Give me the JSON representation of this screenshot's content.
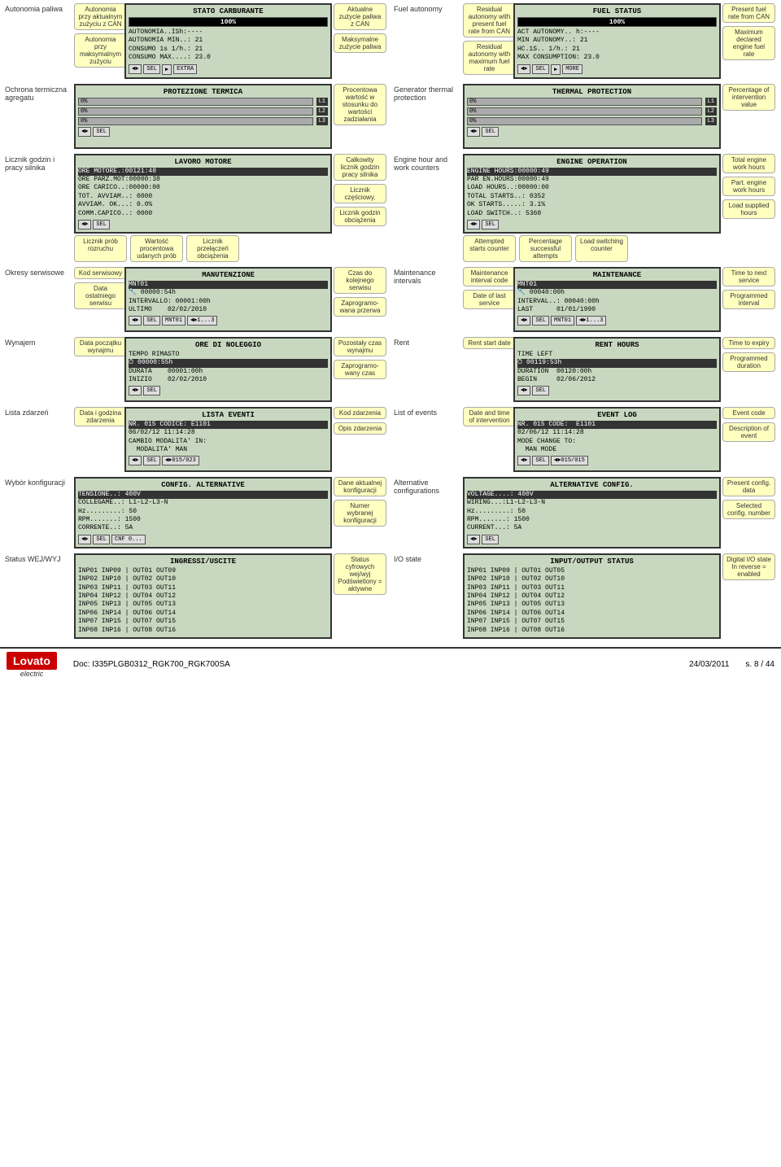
{
  "left_column": {
    "sections": [
      {
        "id": "fuel-autonomy",
        "label": "Autonomia paliwa",
        "screen_title": "STATO CARBURANTE",
        "progress": 100,
        "lines": [
          "AUTONOMIA..ISh:----",
          "AUTONOMIA MIN..: 21",
          "CONSUMO 1s 1/h.: 21",
          "CONSUMO MAX....: 23.0"
        ],
        "controls": [
          "◄►",
          "SEL",
          "▶",
          "EXTRA"
        ],
        "annotations_right": [
          {
            "text": "Aktualne zużycie paliwa z CAN"
          },
          {
            "text": "Maksymalne zużycie paliwa"
          }
        ],
        "annotations_left": [
          {
            "text": "Autonomia przy aktualnym zużyciu z CAN"
          },
          {
            "text": "Autonomia przy maksymalnym zużyciu"
          }
        ]
      },
      {
        "id": "thermal-protection",
        "label": "Ochrona termiczna agregatu",
        "screen_title": "PROTEZIONE TERMICA",
        "lines": [
          "0%",
          "0%",
          "0%"
        ],
        "indicators": [
          "L1",
          "L2",
          "L3"
        ],
        "controls": [
          "◄►",
          "SEL"
        ],
        "annotations_right": [
          {
            "text": "Procentowa wartość w stosunku do wartości zadziałania"
          }
        ]
      },
      {
        "id": "engine-hours",
        "label": "Licznik godzin i pracy silnika",
        "screen_title": "LAVORO MOTORE",
        "lines": [
          "ORE MOTORE.:00121:48",
          "ORE PARZ.MOT:00000:38",
          "ORE CARICO..:00000:00",
          "TOT. AVVIAM..: 0000",
          "AVVIAM. OK...: 0.0%",
          "COMM.CAPICO..: 0000"
        ],
        "controls": [
          "◄►",
          "SEL"
        ],
        "annotations_right": [
          {
            "text": "Całkowity licznik godzin pracy silnika"
          },
          {
            "text": "Licznik częściowy."
          },
          {
            "text": "Licznik godzin obciążenia"
          }
        ],
        "annotations_bottom": [
          {
            "text": "Licznik prób rozruchu"
          },
          {
            "text": "Wartość procentowa udanych prób"
          },
          {
            "text": "Licznik przełączeń obciążenia"
          }
        ]
      },
      {
        "id": "maintenance",
        "label": "Okresy serwisowe",
        "screen_title": "MANUTENZIONE",
        "lines": [
          "MNT01",
          "🔧 00000:54h",
          "INTERVALLO: 00001:00h",
          "ULTIMO    02/02/2010"
        ],
        "controls": [
          "◄►",
          "SEL",
          "MNT01",
          "◄►1...3"
        ],
        "annotations_right": [
          {
            "text": "Czas do kolejnego serwisu"
          },
          {
            "text": "Zaprogramo-wana przerwa"
          }
        ],
        "annotations_left": [
          {
            "text": "Kod serwisowy"
          },
          {
            "text": "Data ostatniego serwisu"
          }
        ]
      },
      {
        "id": "rent",
        "label": "Wynajem",
        "screen_title": "ORE DI NOLEGGIO",
        "lines": [
          "TEMPO RIMASTO",
          "⏱ 00000:55h",
          "DURATA    00001:00h",
          "INIZIO    02/02/2010"
        ],
        "controls": [
          "◄►",
          "SEL"
        ],
        "annotations_right": [
          {
            "text": "Pozostały czas wynajmu"
          },
          {
            "text": "Zaprogramo-wany czas"
          }
        ],
        "annotations_left": [
          {
            "text": "Data początku wynajmu"
          }
        ]
      },
      {
        "id": "events",
        "label": "Lista zdarzeń",
        "screen_title": "LISTA EVENTI",
        "lines": [
          "NR. 015 CODICE: E1101",
          "06/02/12 11:14:28",
          "CAMBIO MODALITA' IN:",
          "  MODALITA' MAN"
        ],
        "controls": [
          "◄►",
          "SEL",
          "◄►015/023"
        ],
        "annotations_right": [
          {
            "text": "Kod zdarzenia"
          },
          {
            "text": "Opis zdarzenia"
          }
        ],
        "annotations_left": [
          {
            "text": "Data i godzina zdarzenia"
          }
        ]
      },
      {
        "id": "alt-config",
        "label": "Wybór konfiguracji",
        "screen_title": "CONFIG. ALTERNATIVE",
        "lines": [
          "TENSIONE..: 400V",
          "COLLEGAME..: L1-L2-L3-N",
          "Hz.........: 50",
          "RPM.......: 1500",
          "CORRENTE..: 5A"
        ],
        "controls": [
          "◄►",
          "SEL",
          "CNF 0..."
        ],
        "annotations_right": [
          {
            "text": "Dane aktualnej konfiguracji"
          },
          {
            "text": "Numer wybranej konfiguracji"
          }
        ]
      },
      {
        "id": "io-state",
        "label": "Status WEJ/WYJ",
        "screen_title": "INGRESSI/USCITE",
        "lines": [
          "INP01 INP09 | OUT01 OUT09",
          "INP02 INP10 | OUT02 OUT10",
          "INP03 INP11 | OUT03 OUT11",
          "INP04 INP12 | OUT04 OUT12",
          "INP05 INP13 | OUT05 OUT13",
          "INP06 INP14 | OUT06 OUT14",
          "INP07 INP15 | OUT07 OUT15",
          "INP08 INP16 | OUT08 OUT16"
        ],
        "controls": [],
        "annotations_right": [
          {
            "text": "Status cyfrowych wej/wyj Podświetlony = aktywne"
          }
        ]
      }
    ]
  },
  "right_column": {
    "sections": [
      {
        "id": "fuel-autonomy-r",
        "label": "Fuel autonomy",
        "screen_title": "FUEL STATUS",
        "progress": 100,
        "lines": [
          "ACT AUTONOMY.. h:----",
          "MIN AUTONOMY..: 21",
          "HC.1S.. 1/h.: 21",
          "MAX CONSUMPTION: 23.0"
        ],
        "controls": [
          "◄►",
          "SEL",
          "▶",
          "MORE"
        ],
        "annotations_right": [
          {
            "text": "Present fuel rate from CAN"
          },
          {
            "text": "Maximum declared engine fuel rate"
          }
        ],
        "annotations_left": [
          {
            "text": "Residual autonomy with present fuel rate from CAN"
          },
          {
            "text": "Residual autonomy with maximum fuel rate"
          }
        ]
      },
      {
        "id": "thermal-protection-r",
        "label": "Generator thermal protection",
        "screen_title": "THERMAL PROTECTION",
        "lines": [
          "0%",
          "0%",
          "0%"
        ],
        "indicators": [
          "L1",
          "L2",
          "L3"
        ],
        "controls": [
          "◄►",
          "SEL"
        ],
        "annotations_right": [
          {
            "text": "Percentage of intervention value"
          }
        ]
      },
      {
        "id": "engine-hours-r",
        "label": "Engine hour and work counters",
        "screen_title": "ENGINE OPERATION",
        "lines": [
          "ENGINE HOURS:00000:49",
          "PAR EN.HOURS:00000:49",
          "LOAD HOURS..:00000:00",
          "TOTAL STARTS..: 0352",
          "OK STARTS.....: 3.1%",
          "LOAD SWITCH..: 5360"
        ],
        "controls": [
          "◄►",
          "SEL"
        ],
        "annotations_right": [
          {
            "text": "Total engine work hours"
          },
          {
            "text": "Part. engine work hours"
          },
          {
            "text": "Load supplied hours"
          }
        ],
        "annotations_bottom": [
          {
            "text": "Attempted starts counter"
          },
          {
            "text": "Percentage successful attempts"
          },
          {
            "text": "Load switching counter"
          }
        ]
      },
      {
        "id": "maintenance-r",
        "label": "Maintenance intervals",
        "screen_title": "MAINTENANCE",
        "lines": [
          "MNT01",
          "🔧 00040:00h",
          "INTERVAL..: 00040:00h",
          "LAST      01/01/1990"
        ],
        "controls": [
          "◄►",
          "SEL",
          "MNT01",
          "◄►1...3"
        ],
        "annotations_right": [
          {
            "text": "Time to next service"
          },
          {
            "text": "Programmed interval"
          }
        ],
        "annotations_left": [
          {
            "text": "Maintenance interval code"
          },
          {
            "text": "Date of last service"
          }
        ]
      },
      {
        "id": "rent-r",
        "label": "Rent",
        "screen_title": "RENT HOURS",
        "lines": [
          "TIME LEFT",
          "⏱ 00119:53h",
          "DURATION  00120:00h",
          "BEGIN     02/06/2012"
        ],
        "controls": [
          "◄►",
          "SEL"
        ],
        "annotations_right": [
          {
            "text": "Time to expiry"
          },
          {
            "text": "Programmed duration"
          }
        ],
        "annotations_left": [
          {
            "text": "Rent start date"
          }
        ]
      },
      {
        "id": "events-r",
        "label": "List of events",
        "screen_title": "EVENT LOG",
        "lines": [
          "NR. 015 CODE:  E1101",
          "02/06/12 11:14:28",
          "MODE CHANGE TO:",
          "  MAN MODE"
        ],
        "controls": [
          "◄►",
          "SEL",
          "◄►015/015"
        ],
        "annotations_right": [
          {
            "text": "Event code"
          },
          {
            "text": "Description of event"
          }
        ],
        "annotations_left": [
          {
            "text": "Date and time of intervention"
          }
        ]
      },
      {
        "id": "alt-config-r",
        "label": "Alternative configurations",
        "screen_title": "ALTERNATIVE CONFIG.",
        "lines": [
          "VOLTAGE....: 400V",
          "WIRING...:L1-L2-L3-N",
          "Hz.........: 50",
          "RPM.......: 1500",
          "CURRENT...: 5A"
        ],
        "controls": [
          "◄►",
          "SEL"
        ],
        "annotations_right": [
          {
            "text": "Present config. data"
          },
          {
            "text": "Selected config. number"
          }
        ]
      },
      {
        "id": "io-state-r",
        "label": "I/O state",
        "screen_title": "INPUT/OUTPUT STATUS",
        "lines": [
          "INP01 INP09 | OUT01 OUT05",
          "INP02 INP10 | OUT02 OUT10",
          "INP03 INP11 | OUT03 OUT11",
          "INP04 INP12 | OUT04 OUT12",
          "INP05 INP13 | OUT05 OUT13",
          "INP06 INP14 | OUT06 OUT14",
          "INP07 INP15 | OUT07 OUT15",
          "INP08 INP16 | OUT08 OUT16"
        ],
        "controls": [],
        "annotations_right": [
          {
            "text": "Digital I/O state In reverse = enabled"
          }
        ]
      }
    ]
  },
  "footer": {
    "logo_main": "Lovato",
    "logo_sub": "electric",
    "doc": "Doc: I335PLGB0312_RGK700_RGK700SA",
    "date": "24/03/2011",
    "page": "s. 8 / 44"
  }
}
